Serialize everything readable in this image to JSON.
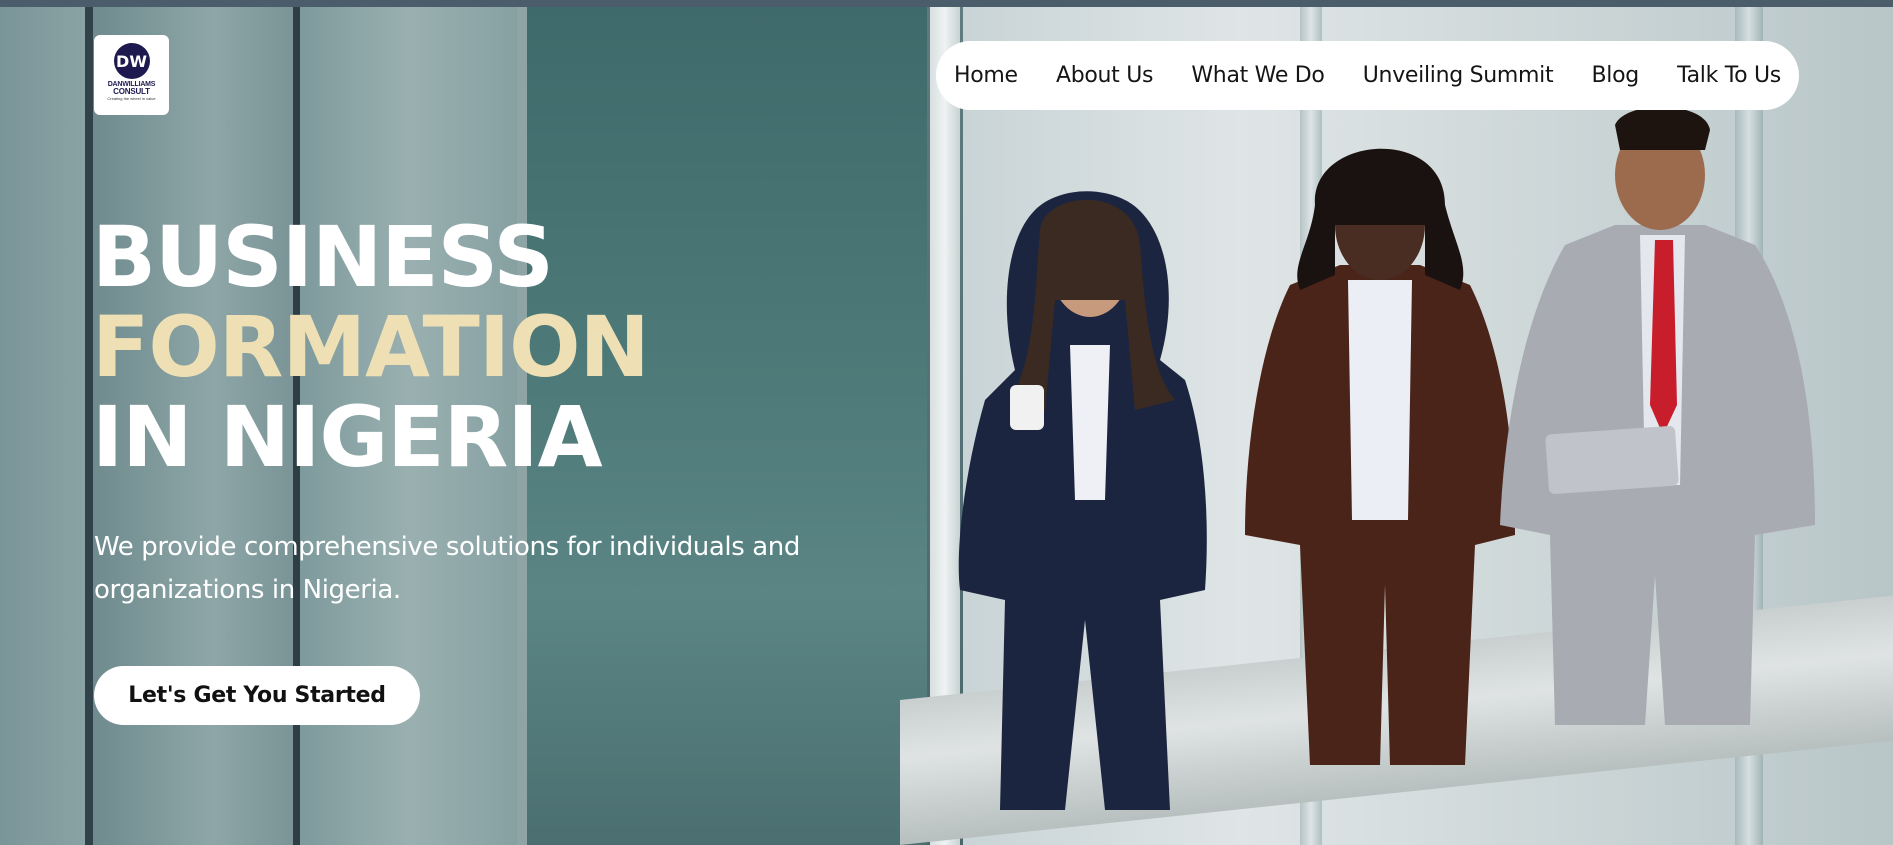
{
  "logo": {
    "mark": "DW",
    "line1": "DANWILLIAMS",
    "line2": "CONSULT",
    "tagline": "Creating the wheel in value"
  },
  "nav": {
    "items": [
      {
        "label": "Home"
      },
      {
        "label": "About Us"
      },
      {
        "label": "What We Do"
      },
      {
        "label": "Unveiling Summit"
      },
      {
        "label": "Blog"
      },
      {
        "label": "Talk To Us"
      }
    ]
  },
  "hero": {
    "line1": "BUSINESS",
    "line2": "FORMATION",
    "line3": "IN NIGERIA",
    "subtext": "We provide comprehensive solutions for individuals and organizations in Nigeria.",
    "cta_label": "Let's Get You Started"
  },
  "colors": {
    "accent_gold": "#eee0b4",
    "logo_navy": "#1e1a4f",
    "text_white": "#ffffff"
  },
  "icons": {
    "logo": "dw-monogram-icon"
  }
}
